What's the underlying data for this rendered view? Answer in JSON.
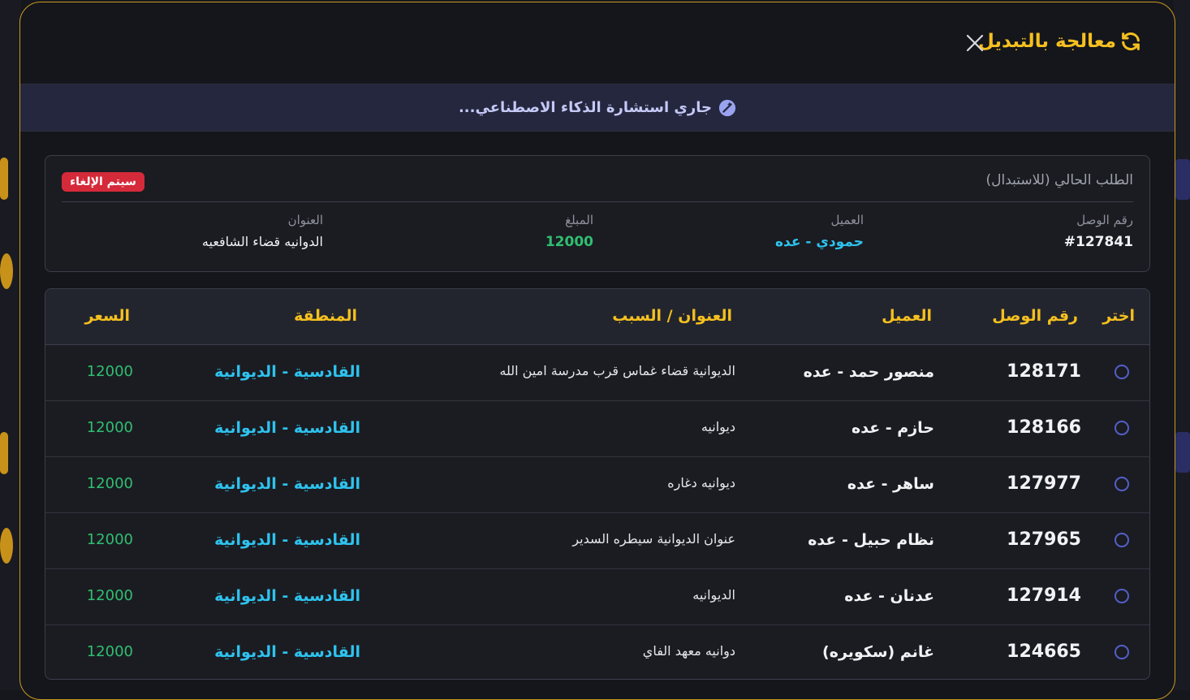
{
  "modal": {
    "title": "معالجة بالتبديل",
    "ai_status": "جاري استشارة الذكاء الاصطناعي..."
  },
  "current_order": {
    "heading": "الطلب الحالي (للاستبدال)",
    "badge": "سيتم الإلغاء",
    "fields": {
      "waybill_label": "رقم الوصل",
      "waybill_value": "#127841",
      "client_label": "العميل",
      "client_value": "حمودي - عده",
      "amount_label": "المبلغ",
      "amount_value": "12000",
      "address_label": "العنوان",
      "address_value": "الدوانيه قضاء الشافعيه"
    }
  },
  "table": {
    "headers": {
      "select": "اختر",
      "waybill": "رقم الوصل",
      "client": "العميل",
      "address": "العنوان / السبب",
      "region": "المنطقة",
      "price": "السعر"
    },
    "rows": [
      {
        "waybill": "128171",
        "client": "منصور حمد - عده",
        "address": "الديوانية قضاء غماس قرب مدرسة امين الله",
        "region": "القادسية - الديوانية",
        "price": "12000"
      },
      {
        "waybill": "128166",
        "client": "حازم - عده",
        "address": "ديوانيه",
        "region": "القادسية - الديوانية",
        "price": "12000"
      },
      {
        "waybill": "127977",
        "client": "ساهر - عده",
        "address": "ديوانيه دغاره",
        "region": "القادسية - الديوانية",
        "price": "12000"
      },
      {
        "waybill": "127965",
        "client": "نظام حبيل - عده",
        "address": "عنوان الديوانية سيطره السدير",
        "region": "القادسية - الديوانية",
        "price": "12000"
      },
      {
        "waybill": "127914",
        "client": "عدنان - عده",
        "address": "الديوانيه",
        "region": "القادسية - الديوانية",
        "price": "12000"
      },
      {
        "waybill": "124665",
        "client": "غانم (سكويره)",
        "address": "دوانيه معهد الفاي",
        "region": "القادسية - الديوانية",
        "price": "12000"
      }
    ]
  },
  "colors": {
    "accent": "#f5c01f",
    "region": "#2ec3ee",
    "price": "#2fbf71",
    "cancel": "#d52a3a",
    "radio": "#5160c8"
  }
}
